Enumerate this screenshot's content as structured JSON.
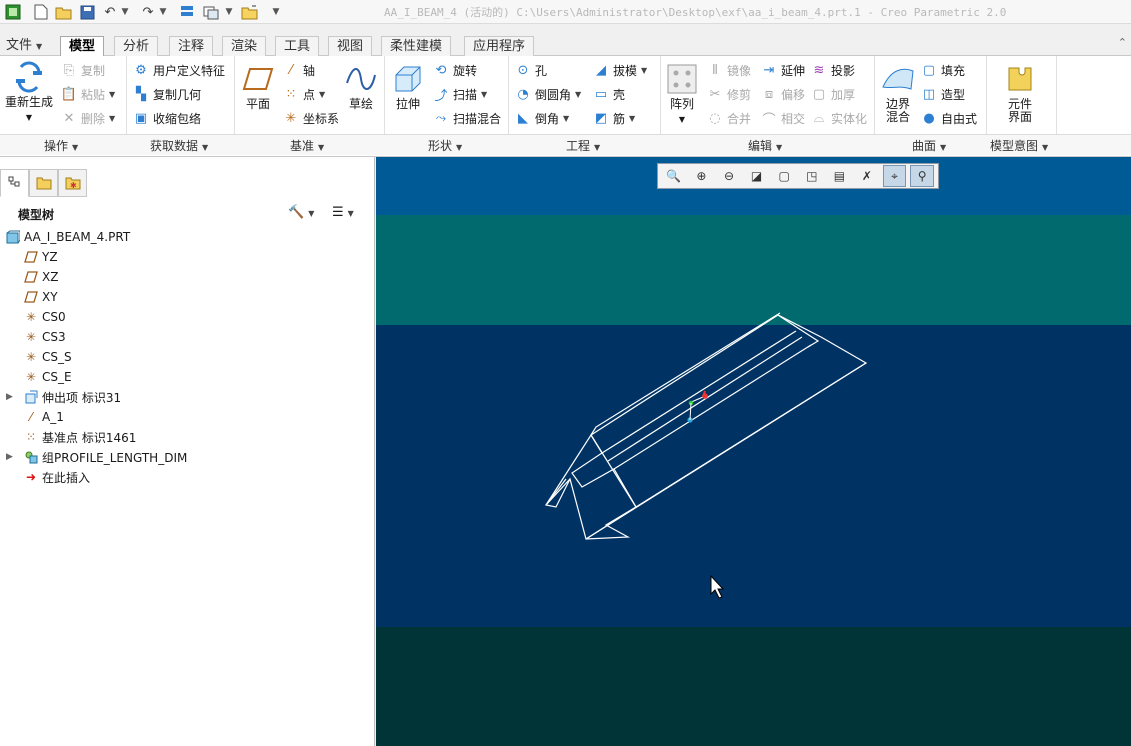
{
  "window": {
    "title": "AA_I_BEAM_4 (活动的) C:\\Users\\Administrator\\Desktop\\exf\\aa_i_beam_4.prt.1 - Creo Parametric 2.0"
  },
  "tabs": [
    {
      "label": "文件"
    },
    {
      "label": "模型"
    },
    {
      "label": "分析"
    },
    {
      "label": "注释"
    },
    {
      "label": "渲染"
    },
    {
      "label": "工具"
    },
    {
      "label": "视图"
    },
    {
      "label": "柔性建模"
    },
    {
      "label": "应用程序"
    }
  ],
  "ribbon": {
    "regenerate": "重新生成",
    "copy": "复制",
    "paste": "粘贴",
    "delete": "删除",
    "udf": "用户定义特征",
    "copy_geom": "复制几何",
    "shrinkwrap": "收缩包络",
    "plane": "平面",
    "axis": "轴",
    "point": "点",
    "csys": "坐标系",
    "sketch": "草绘",
    "extrude": "拉伸",
    "revolve": "旋转",
    "sweep": "扫描",
    "swept_blend": "扫描混合",
    "hole": "孔",
    "round": "倒圆角",
    "chamfer": "倒角",
    "draft": "拔模",
    "shell": "壳",
    "rib": "筋",
    "pattern": "阵列",
    "mirror": "镜像",
    "trim": "修剪",
    "merge": "合并",
    "extend": "延伸",
    "offset": "偏移",
    "intersect": "相交",
    "project": "投影",
    "thicken": "加厚",
    "solidify": "实体化",
    "boundary_blend": "边界混合",
    "fill": "填充",
    "style": "造型",
    "freestyle": "自由式",
    "component_interface": "元件界面",
    "groups": [
      "操作",
      "获取数据",
      "基准",
      "形状",
      "工程",
      "编辑",
      "曲面",
      "模型意图"
    ]
  },
  "panel": {
    "title": "模型树",
    "tree": [
      {
        "label": "AA_I_BEAM_4.PRT",
        "icon": "part-icon",
        "expand": false
      },
      {
        "label": "YZ",
        "icon": "plane-icon",
        "expand": false
      },
      {
        "label": "XZ",
        "icon": "plane-icon",
        "expand": false
      },
      {
        "label": "XY",
        "icon": "plane-icon",
        "expand": false
      },
      {
        "label": "CS0",
        "icon": "csys-icon",
        "expand": false
      },
      {
        "label": "CS3",
        "icon": "csys-icon",
        "expand": false
      },
      {
        "label": "CS_S",
        "icon": "csys-icon",
        "expand": false
      },
      {
        "label": "CS_E",
        "icon": "csys-icon",
        "expand": false
      },
      {
        "label": "伸出项 标识31",
        "icon": "protrusion-icon",
        "expand": true
      },
      {
        "label": "A_1",
        "icon": "axis-icon",
        "expand": false
      },
      {
        "label": "基准点 标识1461",
        "icon": "datum-point-icon",
        "expand": false
      },
      {
        "label": "组PROFILE_LENGTH_DIM",
        "icon": "group-icon",
        "expand": true
      },
      {
        "label": "在此插入",
        "icon": "insert-here-icon",
        "expand": false
      }
    ]
  },
  "colors": {
    "viewport_band1": "#005a96",
    "viewport_band2": "#006a6e",
    "viewport_band3": "#003363",
    "viewport_band4": "#013436",
    "wireframe": "#ffffff"
  }
}
